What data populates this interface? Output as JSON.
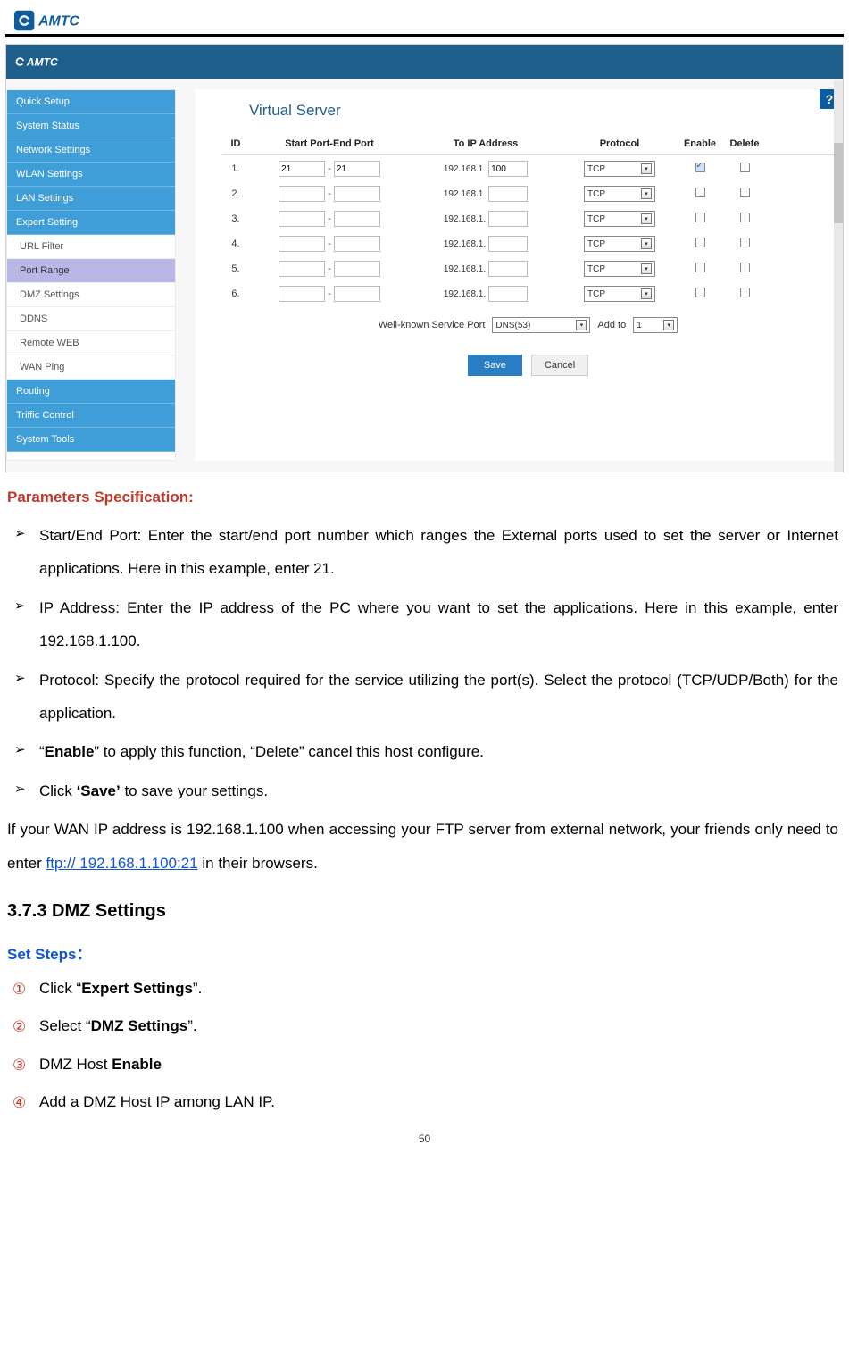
{
  "header": {
    "brand": "AMTC"
  },
  "screenshot": {
    "brand": "AMTC",
    "help_icon": "?",
    "title": "Virtual Server",
    "sidebar_primary": [
      "Quick Setup",
      "System Status",
      "Network Settings",
      "WLAN Settings",
      "LAN Settings",
      "Expert Setting"
    ],
    "sidebar_sub": [
      "URL Filter",
      "Port Range",
      "DMZ Settings",
      "DDNS",
      "Remote WEB",
      "WAN Ping"
    ],
    "sidebar_sub_active_index": 1,
    "sidebar_primary_tail": [
      "Routing",
      "Triffic Control",
      "System Tools"
    ],
    "columns": {
      "id": "ID",
      "port": "Start Port-End Port",
      "ip": "To IP Address",
      "protocol": "Protocol",
      "enable": "Enable",
      "delete": "Delete"
    },
    "ip_prefix": "192.168.1.",
    "rows": [
      {
        "id": "1.",
        "start": "21",
        "end": "21",
        "ip_suffix": "100",
        "protocol": "TCP",
        "enable": true,
        "delete": false
      },
      {
        "id": "2.",
        "start": "",
        "end": "",
        "ip_suffix": "",
        "protocol": "TCP",
        "enable": false,
        "delete": false
      },
      {
        "id": "3.",
        "start": "",
        "end": "",
        "ip_suffix": "",
        "protocol": "TCP",
        "enable": false,
        "delete": false
      },
      {
        "id": "4.",
        "start": "",
        "end": "",
        "ip_suffix": "",
        "protocol": "TCP",
        "enable": false,
        "delete": false
      },
      {
        "id": "5.",
        "start": "",
        "end": "",
        "ip_suffix": "",
        "protocol": "TCP",
        "enable": false,
        "delete": false
      },
      {
        "id": "6.",
        "start": "",
        "end": "",
        "ip_suffix": "",
        "protocol": "TCP",
        "enable": false,
        "delete": false
      }
    ],
    "wellknown": {
      "label": "Well-known Service Port",
      "service": "DNS(53)",
      "addto": "Add to",
      "idsel": "1"
    },
    "buttons": {
      "save": "Save",
      "cancel": "Cancel"
    }
  },
  "spec_title": "Parameters Specification:",
  "bullets": [
    {
      "text": "Start/End Port: Enter the start/end port number which ranges the External ports used to set the server or Internet applications. Here in this example, enter 21."
    },
    {
      "text": "IP Address: Enter the IP address of the PC where you want to set the applications. Here in this example, enter 192.168.1.100."
    },
    {
      "text": "Protocol: Specify the protocol required for the service utilizing the port(s). Select the protocol (TCP/UDP/Both) for the application."
    },
    {
      "pre": "“",
      "bold": "Enable",
      "post": "” to apply this function, “Delete” cancel this host configure."
    },
    {
      "pre": "Click ",
      "bold": "‘Save’",
      "post": " to save your settings."
    }
  ],
  "para": {
    "pre": "If your WAN IP address is 192.168.1.100 when accessing your FTP server from external network, your friends only need to enter ",
    "link": "ftp:// 192.168.1.100:21",
    "post": " in their browsers."
  },
  "h3": "3.7.3 DMZ Settings",
  "steps_title": "Set Steps：",
  "steps": [
    {
      "num": "①",
      "pre": "Click “",
      "bold": "Expert Settings",
      "post": "”."
    },
    {
      "num": "②",
      "pre": "Select “",
      "bold": "DMZ Settings",
      "post": "”."
    },
    {
      "num": "③",
      "pre": "DMZ Host ",
      "bold": "Enable",
      "post": ""
    },
    {
      "num": "④",
      "pre": "Add a DMZ Host IP among LAN IP.",
      "bold": "",
      "post": ""
    }
  ],
  "page_number": "50"
}
